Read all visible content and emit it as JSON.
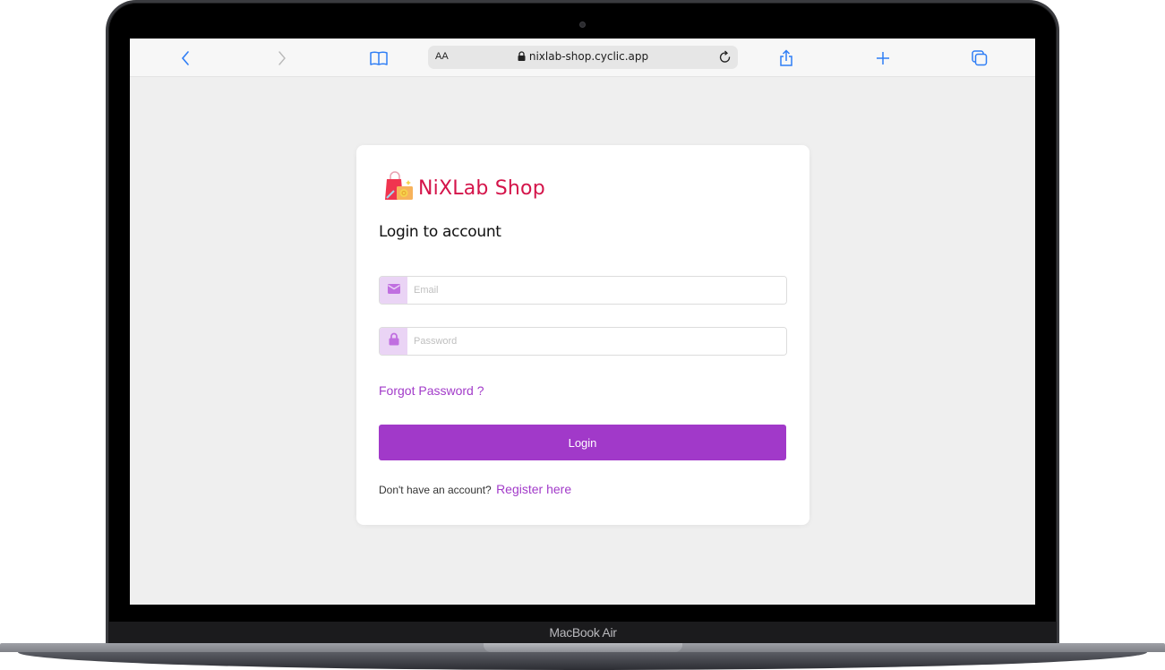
{
  "device": {
    "label": "MacBook Air"
  },
  "browser": {
    "url_text_size_label": "AA",
    "url": "nixlab-shop.cyclic.app",
    "buttons": {
      "back": "back-icon",
      "forward": "forward-icon",
      "bookmarks": "book-icon",
      "reload": "reload-icon",
      "share": "share-icon",
      "new_tab": "plus-icon",
      "tabs": "tabs-icon"
    }
  },
  "page": {
    "brand": {
      "name": "NiXLab Shop",
      "color": "#d4144a"
    },
    "title": "Login to account",
    "email": {
      "placeholder": "Email",
      "value": "",
      "icon": "envelope-icon"
    },
    "password": {
      "placeholder": "Password",
      "value": "",
      "icon": "lock-icon"
    },
    "forgot_password": "Forgot Password ?",
    "login_button": "Login",
    "register_prompt": "Don't have an account?",
    "register_link": "Register here",
    "accent_color": "#a139c9"
  }
}
